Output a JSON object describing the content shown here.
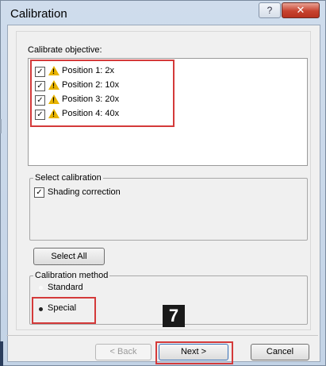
{
  "window": {
    "title": "Calibration",
    "help_label": "?",
    "close_label": "✕"
  },
  "objective": {
    "label": "Calibrate objective:",
    "items": [
      {
        "label": "Position 1: 2x",
        "checked": true
      },
      {
        "label": "Position 2: 10x",
        "checked": true
      },
      {
        "label": "Position 3: 20x",
        "checked": true
      },
      {
        "label": "Position 4: 40x",
        "checked": true
      }
    ],
    "check_mark": "✓",
    "warn_mark": "!"
  },
  "select_calibration": {
    "legend": "Select calibration",
    "shading_label": "Shading correction",
    "shading_checked": true,
    "check_mark": "✓"
  },
  "buttons": {
    "select_all": "Select All",
    "back": "< Back",
    "next": "Next >",
    "cancel": "Cancel"
  },
  "calibration_method": {
    "legend": "Calibration method",
    "options": [
      "Standard",
      "Special"
    ],
    "selected": "Special"
  },
  "step_badge": "7",
  "colors": {
    "highlight": "#d43a3a",
    "warning": "#e8b400",
    "close_button": "#c7432f"
  }
}
